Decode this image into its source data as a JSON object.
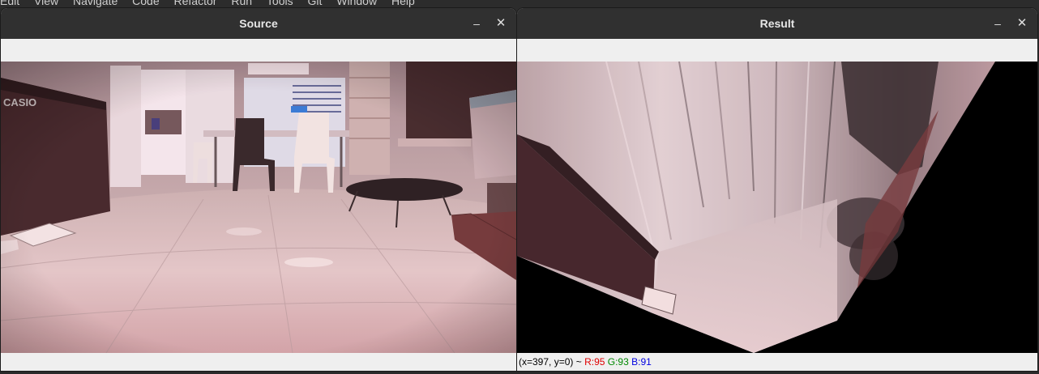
{
  "ide_menu": [
    "Edit",
    "View",
    "Navigate",
    "Code",
    "Refactor",
    "Run",
    "Tools",
    "Git",
    "Window",
    "Help"
  ],
  "source_window": {
    "title": "Source",
    "minimize_glyph": "–",
    "close_glyph": "✕",
    "image_text": "CASIO"
  },
  "result_window": {
    "title": "Result",
    "minimize_glyph": "–",
    "close_glyph": "✕",
    "status": {
      "coords": "(x=397, y=0) ~",
      "r": "R:95",
      "g": "G:93",
      "b": "B:91"
    }
  }
}
